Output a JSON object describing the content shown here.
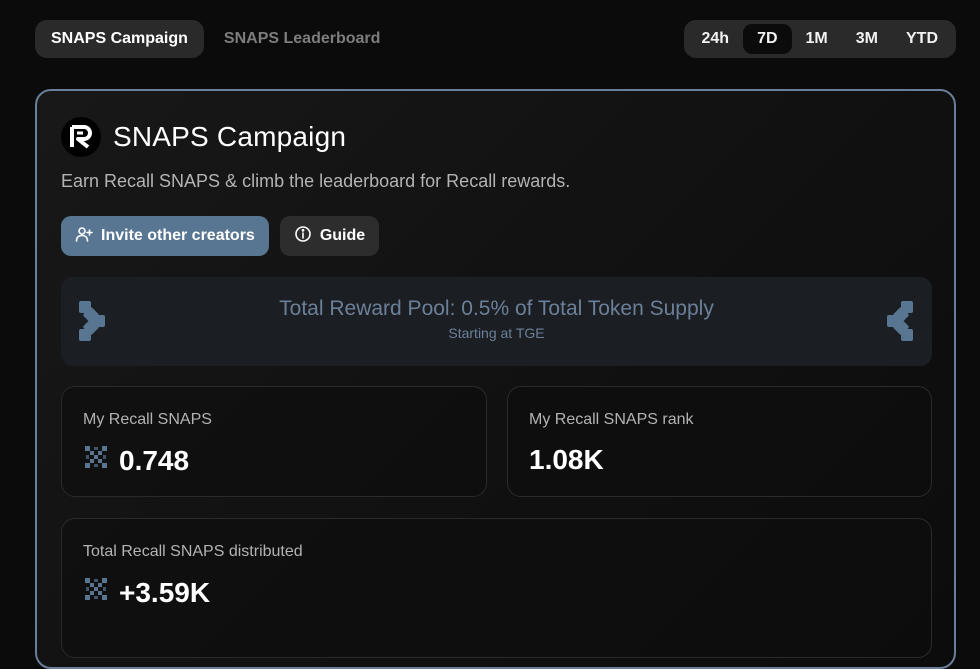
{
  "nav": {
    "tabs": [
      {
        "label": "SNAPS Campaign",
        "active": true
      },
      {
        "label": "SNAPS Leaderboard",
        "active": false
      }
    ],
    "ranges": [
      {
        "label": "24h",
        "active": false
      },
      {
        "label": "7D",
        "active": true
      },
      {
        "label": "1M",
        "active": false
      },
      {
        "label": "3M",
        "active": false
      },
      {
        "label": "YTD",
        "active": false
      }
    ]
  },
  "card": {
    "logo_icon": "recall-logo-icon",
    "title": "SNAPS Campaign",
    "description": "Earn Recall SNAPS & climb the leaderboard for Recall rewards.",
    "invite_label": "Invite other creators",
    "guide_label": "Guide",
    "pool_title": "Total Reward Pool: 0.5% of Total Token Supply",
    "pool_subtitle": "Starting at TGE"
  },
  "stats": {
    "my_snaps": {
      "label": "My Recall SNAPS",
      "value": "0.748"
    },
    "my_rank": {
      "label": "My Recall SNAPS rank",
      "value": "1.08K"
    },
    "distributed": {
      "label": "Total Recall SNAPS distributed",
      "value": "+3.59K"
    }
  },
  "colors": {
    "accent": "#587591",
    "border": "#6a7f99",
    "pool_text": "#6b8098"
  }
}
